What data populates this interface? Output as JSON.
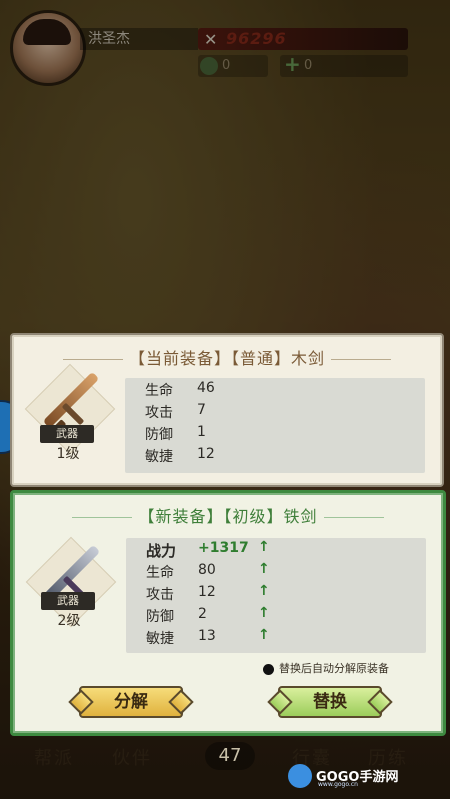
{
  "player": {
    "name": "洪圣杰",
    "power": "96296"
  },
  "resources": [
    {
      "icon": "gem-icon",
      "value": "0"
    },
    {
      "icon": "plus-icon",
      "value": "0"
    }
  ],
  "current_equipment": {
    "title": "【当前装备】【普通】木剑",
    "slot_tag": "武器",
    "level": "1级",
    "stats": [
      {
        "label": "生命",
        "value": "46"
      },
      {
        "label": "攻击",
        "value": "7"
      },
      {
        "label": "防御",
        "value": "1"
      },
      {
        "label": "敏捷",
        "value": "12"
      }
    ]
  },
  "new_equipment": {
    "title": "【新装备】【初级】铁剑",
    "slot_tag": "武器",
    "level": "2级",
    "power": {
      "label": "战力",
      "value": "+1317",
      "arrow": "↑"
    },
    "stats": [
      {
        "label": "生命",
        "value": "80",
        "arrow": "↑"
      },
      {
        "label": "攻击",
        "value": "12",
        "arrow": "↑"
      },
      {
        "label": "防御",
        "value": "2",
        "arrow": "↑"
      },
      {
        "label": "敏捷",
        "value": "13",
        "arrow": "↑"
      }
    ],
    "auto_note": "替换后自动分解原装备"
  },
  "buttons": {
    "decompose": "分解",
    "replace": "替换"
  },
  "bottom_nav": {
    "items": [
      "帮派",
      "伙伴",
      "行囊",
      "历练"
    ],
    "count": "47"
  },
  "watermark": {
    "text": "GOGO手游网",
    "sub": "www.gogo.cn"
  }
}
